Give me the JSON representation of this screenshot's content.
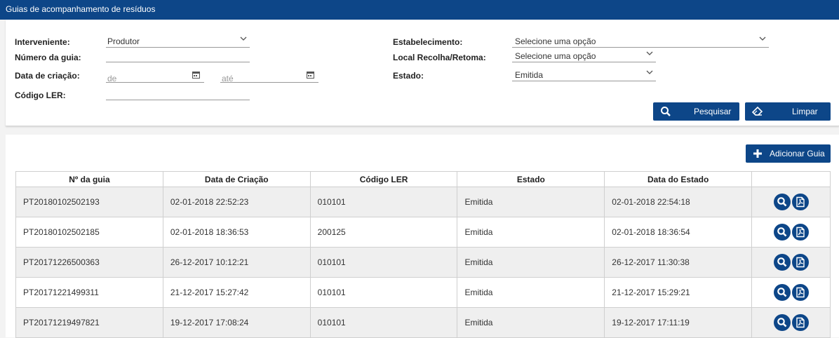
{
  "header": {
    "title": "Guias de acompanhamento de resíduos"
  },
  "filters": {
    "interveniente": {
      "label": "Interveniente:",
      "value": "Produtor"
    },
    "numero_guia": {
      "label": "Número da guia:",
      "value": ""
    },
    "data_criacao": {
      "label": "Data de criação:",
      "from_placeholder": "de",
      "to_placeholder": "até"
    },
    "codigo_ler": {
      "label": "Código LER:",
      "value": ""
    },
    "estabelecimento": {
      "label": "Estabelecimento:",
      "value": "Selecione uma opção"
    },
    "local_recolha": {
      "label": "Local Recolha/Retoma:",
      "value": "Selecione uma opção"
    },
    "estado": {
      "label": "Estado:",
      "value": "Emitida"
    },
    "search_label": "Pesquisar",
    "clear_label": "Limpar"
  },
  "results": {
    "add_label": "Adicionar Guia",
    "columns": [
      "Nº da guia",
      "Data de Criação",
      "Código LER",
      "Estado",
      "Data do Estado",
      ""
    ],
    "rows": [
      [
        "PT20180102502193",
        "02-01-2018 22:52:23",
        "010101",
        "Emitida",
        "02-01-2018 22:54:18"
      ],
      [
        "PT20180102502185",
        "02-01-2018 18:36:53",
        "200125",
        "Emitida",
        "02-01-2018 18:36:54"
      ],
      [
        "PT20171226500363",
        "26-12-2017 10:12:21",
        "010101",
        "Emitida",
        "26-12-2017 11:30:38"
      ],
      [
        "PT20171221499311",
        "21-12-2017 15:27:42",
        "010101",
        "Emitida",
        "21-12-2017 15:29:21"
      ],
      [
        "PT20171219497821",
        "19-12-2017 17:08:24",
        "010101",
        "Emitida",
        "19-12-2017 17:11:19"
      ]
    ]
  },
  "icons": {
    "search": "search-icon",
    "eraser": "eraser-icon",
    "add": "plus-icon",
    "calendar": "calendar-icon",
    "chevron": "chevron-down-icon",
    "pdf": "pdf-icon"
  },
  "colors": {
    "brand": "#0d4688",
    "row_alt": "#efefef"
  }
}
